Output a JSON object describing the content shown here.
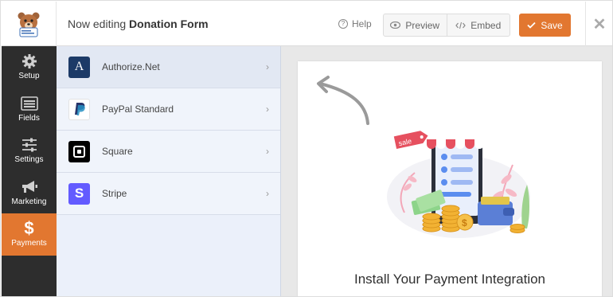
{
  "header": {
    "editing_prefix": "Now editing",
    "form_name": "Donation Form",
    "help_label": "Help",
    "preview_label": "Preview",
    "embed_label": "Embed",
    "save_label": "Save"
  },
  "sidebar": {
    "items": [
      {
        "label": "Setup",
        "icon": "gear-icon"
      },
      {
        "label": "Fields",
        "icon": "fields-icon"
      },
      {
        "label": "Settings",
        "icon": "sliders-icon"
      },
      {
        "label": "Marketing",
        "icon": "megaphone-icon"
      },
      {
        "label": "Payments",
        "icon": "dollar-icon",
        "active": true
      }
    ]
  },
  "payments": {
    "items": [
      {
        "label": "Authorize.Net",
        "icon": "authorize-net-logo"
      },
      {
        "label": "PayPal Standard",
        "icon": "paypal-logo"
      },
      {
        "label": "Square",
        "icon": "square-logo"
      },
      {
        "label": "Stripe",
        "icon": "stripe-logo"
      }
    ]
  },
  "preview": {
    "heading": "Install Your Payment Integration",
    "sale_tag": "sale"
  },
  "colors": {
    "accent": "#e27730",
    "sidebar_bg": "#2d2d2d",
    "panel_bg": "#ebf0fa",
    "stripe": "#635bff"
  }
}
